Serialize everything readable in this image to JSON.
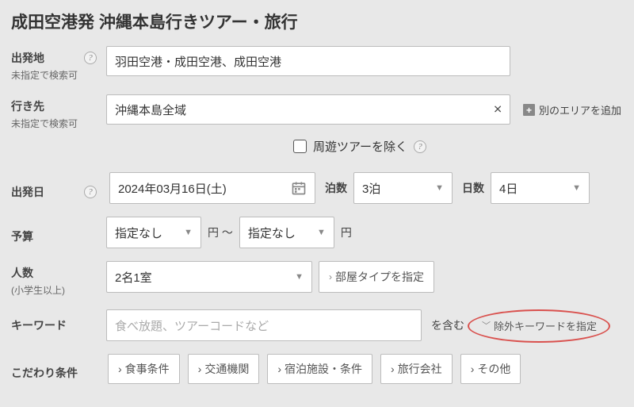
{
  "title": "成田空港発 沖縄本島行きツアー・旅行",
  "departure": {
    "label": "出発地",
    "sub": "未指定で検索可",
    "value": "羽田空港・成田空港、成田空港"
  },
  "destination": {
    "label": "行き先",
    "sub": "未指定で検索可",
    "value": "沖縄本島全域",
    "add_area": "別のエリアを追加"
  },
  "exclude_round": {
    "label": "周遊ツアーを除く"
  },
  "depart_date": {
    "label": "出発日",
    "value": "2024年03月16日(土)"
  },
  "nights": {
    "label": "泊数",
    "value": "3泊"
  },
  "days": {
    "label": "日数",
    "value": "4日"
  },
  "budget": {
    "label": "予算",
    "from": "指定なし",
    "to": "指定なし",
    "unit_from": "円 〜",
    "unit_to": "円"
  },
  "people": {
    "label": "人数",
    "sub": "(小学生以上)",
    "value": "2名1室",
    "room_type_btn": "部屋タイプを指定"
  },
  "keyword": {
    "label": "キーワード",
    "placeholder": "食べ放題、ツアーコードなど",
    "suffix": "を含む",
    "exclude_btn": "除外キーワードを指定"
  },
  "conditions": {
    "label": "こだわり条件",
    "items": [
      "食事条件",
      "交通機関",
      "宿泊施設・条件",
      "旅行会社",
      "その他"
    ]
  }
}
